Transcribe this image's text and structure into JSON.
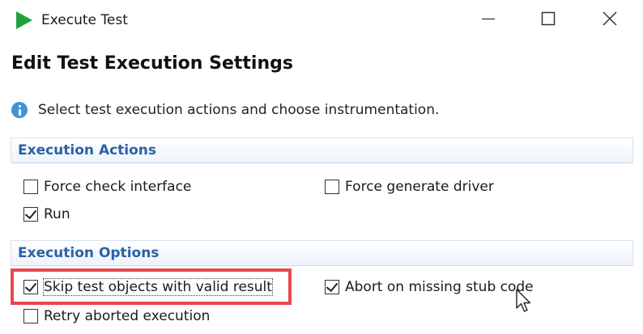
{
  "window": {
    "title": "Execute Test",
    "icon": "play-icon",
    "accent_color": "#22a33a"
  },
  "page": {
    "title": "Edit Test Execution Settings",
    "info_text": "Select test execution actions and choose instrumentation."
  },
  "sections": {
    "actions": {
      "title": "Execution Actions",
      "force_check_interface": {
        "label": "Force check interface",
        "checked": false
      },
      "force_generate_driver": {
        "label": "Force generate driver",
        "checked": false
      },
      "run": {
        "label": "Run",
        "checked": true
      }
    },
    "options": {
      "title": "Execution Options",
      "skip_valid": {
        "label": "Skip test objects with valid result",
        "checked": true
      },
      "abort_missing_stub": {
        "label": "Abort on missing stub code",
        "checked": true
      },
      "retry_aborted": {
        "label": "Retry aborted execution",
        "checked": false
      }
    }
  },
  "colors": {
    "section_title": "#2a62a6",
    "highlight": "#e8474f",
    "info_icon": "#3d94d8"
  }
}
